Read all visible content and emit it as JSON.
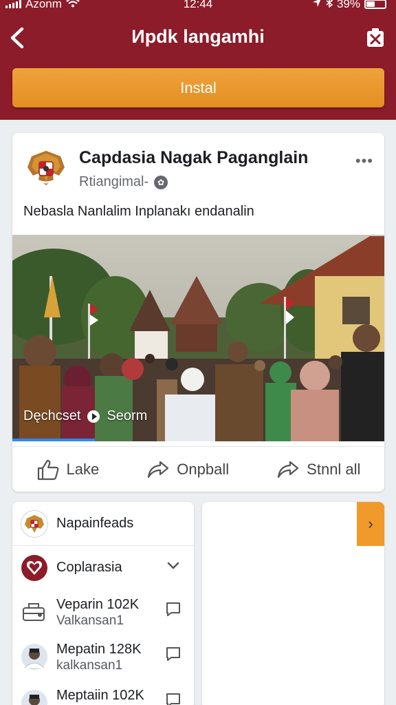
{
  "status": {
    "carrier": "Azonm",
    "time": "12:44",
    "battery": "39%"
  },
  "header": {
    "title": "Иpdk langamhi",
    "install_label": "Instal"
  },
  "post": {
    "page_name": "Capdasia Nagak Paganglain",
    "subtitle": "Rtiangimal-",
    "text": "Nebasla Nanlalim Inplanakı endanalin",
    "caption_left": "Dęchcset",
    "caption_right": "Seorm",
    "actions": [
      {
        "label": "Lake",
        "icon": "thumbs-up-icon"
      },
      {
        "label": "Onpball",
        "icon": "share-arrow-icon"
      },
      {
        "label": "Stnnl all",
        "icon": "share-arrow-icon"
      }
    ]
  },
  "panel": {
    "title": "Napainfeads",
    "dropdown_label": "Coplarasia",
    "items": [
      {
        "title": "Veparin 102K",
        "subtitle": "Valkansan1"
      },
      {
        "title": "Mepatin 128K",
        "subtitle": "kalkansan1"
      },
      {
        "title": "Meptaiin 102K",
        "subtitle": ""
      }
    ]
  },
  "colors": {
    "header_bg": "#8c1c2a",
    "install_bg": "#e8942a",
    "accent_tab": "#ef9a2a"
  }
}
